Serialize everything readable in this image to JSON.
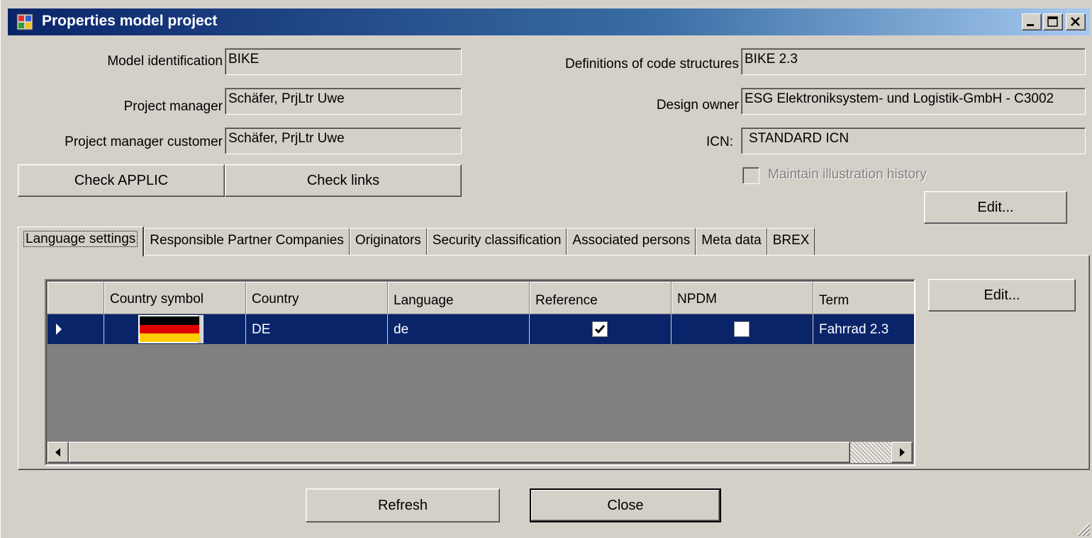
{
  "window": {
    "title": "Properties model project",
    "controls": [
      "minimize-icon",
      "maximize-icon",
      "close-icon"
    ]
  },
  "form": {
    "model_identification": {
      "label": "Model identification",
      "value": "BIKE"
    },
    "project_manager": {
      "label": "Project manager",
      "value": "Schäfer, PrjLtr Uwe"
    },
    "project_manager_customer": {
      "label": "Project manager customer",
      "value": "Schäfer, PrjLtr Uwe"
    },
    "definitions_code_structures": {
      "label": "Definitions of code structures",
      "value": "BIKE 2.3"
    },
    "design_owner": {
      "label": "Design owner",
      "value": "ESG Elektroniksystem- und Logistik-GmbH - C3002"
    },
    "icn": {
      "label": "ICN:",
      "value": "STANDARD ICN"
    },
    "maintain_history": {
      "label": "Maintain illustration history",
      "checked": false,
      "enabled": false
    }
  },
  "buttons": {
    "check_applic": "Check APPLIC",
    "check_links": "Check links",
    "edit_top": "Edit...",
    "edit_grid": "Edit...",
    "refresh": "Refresh",
    "close": "Close"
  },
  "tabs": [
    {
      "label": "Language settings",
      "active": true
    },
    {
      "label": "Responsible Partner Companies",
      "active": false
    },
    {
      "label": "Originators",
      "active": false
    },
    {
      "label": "Security classification",
      "active": false
    },
    {
      "label": "Associated persons",
      "active": false
    },
    {
      "label": "Meta data",
      "active": false
    },
    {
      "label": "BREX",
      "active": false
    }
  ],
  "grid": {
    "columns": [
      "Country symbol",
      "Country",
      "Language",
      "Reference",
      "NPDM",
      "Term"
    ],
    "rows": [
      {
        "country_symbol": "flag-de-icon",
        "country": "DE",
        "language": "de",
        "reference": true,
        "npdm": false,
        "term": "Fahrrad 2.3"
      }
    ]
  },
  "colors": {
    "selection": "#0a246a",
    "face": "#d4d0c8",
    "grid_background": "#808080"
  }
}
